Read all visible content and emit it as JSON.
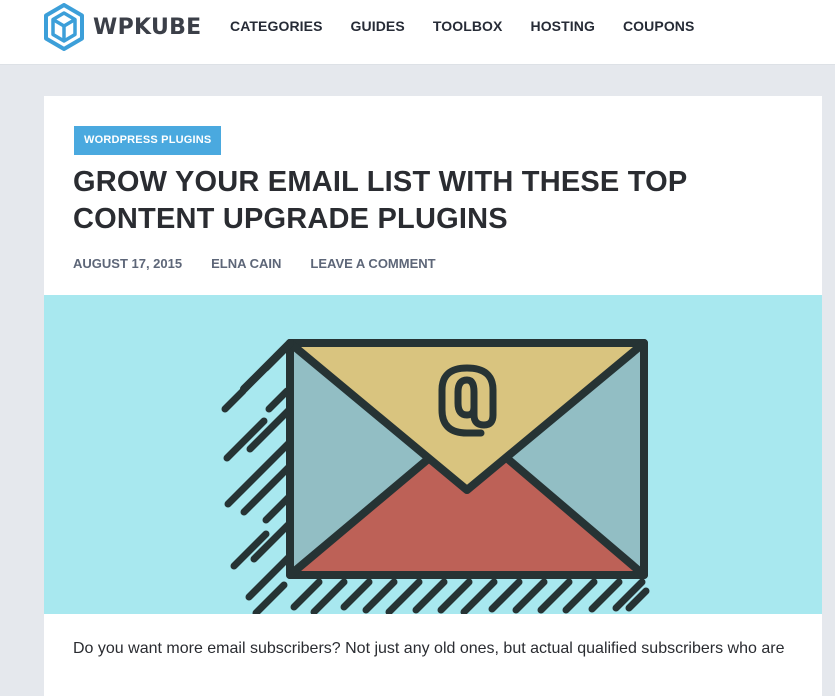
{
  "header": {
    "logo_text": "WPKUBE",
    "brand_color": "#3c9fd9",
    "nav": [
      {
        "label": "CATEGORIES"
      },
      {
        "label": "GUIDES"
      },
      {
        "label": "TOOLBOX"
      },
      {
        "label": "HOSTING"
      },
      {
        "label": "COUPONS"
      }
    ]
  },
  "article": {
    "category": "WORDPRESS PLUGINS",
    "category_color": "#4aa9df",
    "title": "GROW YOUR EMAIL LIST WITH THESE TOP CONTENT UPGRADE PLUGINS",
    "meta": {
      "date": "AUGUST 17, 2015",
      "author": "ELNA CAIN",
      "comments": "LEAVE A COMMENT"
    },
    "hero": {
      "icon": "envelope-at-icon",
      "background": "#a8e8ef",
      "colors": {
        "outline": "#263334",
        "flap": "#d9c47f",
        "sides": "#92bec4",
        "bottom": "#bd6157"
      }
    },
    "intro": "Do you want more email subscribers? Not just any old ones, but actual qualified subscribers who are"
  }
}
